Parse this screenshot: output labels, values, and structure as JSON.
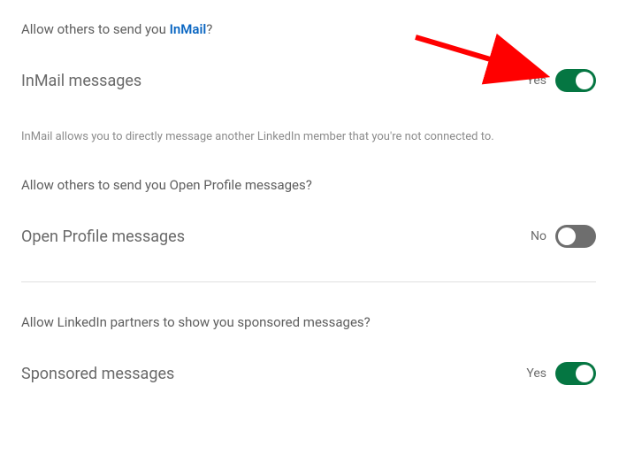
{
  "sections": {
    "inmail": {
      "question_prefix": "Allow others to send you ",
      "question_brand": "InMail",
      "question_suffix": "?",
      "title": "InMail messages",
      "toggle_state": "Yes",
      "description": "InMail allows you to directly message another LinkedIn member that you're not connected to."
    },
    "open_profile": {
      "question": "Allow others to send you Open Profile messages?",
      "title": "Open Profile messages",
      "toggle_state": "No"
    },
    "sponsored": {
      "question": "Allow LinkedIn partners to show you sponsored messages?",
      "title": "Sponsored messages",
      "toggle_state": "Yes"
    }
  }
}
